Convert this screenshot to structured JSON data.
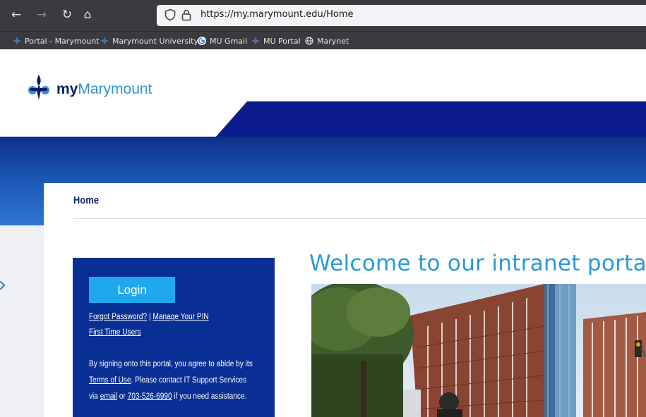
{
  "browser": {
    "url": "https://my.marymount.edu/Home",
    "bookmarks": [
      {
        "label": "Portal - Marymount",
        "icon": "marymount-fleur-icon"
      },
      {
        "label": "Marymount University",
        "icon": "marymount-fleur-icon"
      },
      {
        "label": "MU Gmail",
        "icon": "google-icon"
      },
      {
        "label": "MU Portal",
        "icon": "marymount-fleur-icon"
      },
      {
        "label": "Marynet",
        "icon": "globe-icon"
      }
    ]
  },
  "site": {
    "logo_my": "my",
    "logo_rest": "Marymount"
  },
  "breadcrumb": "Home",
  "login": {
    "button_label": "Login",
    "forgot_password": "Forgot Password?",
    "separator": "|",
    "manage_pin": "Manage Your PIN",
    "first_time": "First Time Users",
    "notice_1": "By signing onto this portal, you agree to abide by its",
    "terms": "Terms of Use",
    "notice_2": ". Please contact IT Support Services",
    "via": "via",
    "email": "email",
    "or": "or",
    "phone": "703-526-6990",
    "notice_3": "if you need assistance."
  },
  "welcome_title": "Welcome to our intranet portal",
  "colors": {
    "brand_navy": "#0a2f94",
    "brand_blue": "#2a9ad9",
    "login_button": "#20a8ee"
  }
}
